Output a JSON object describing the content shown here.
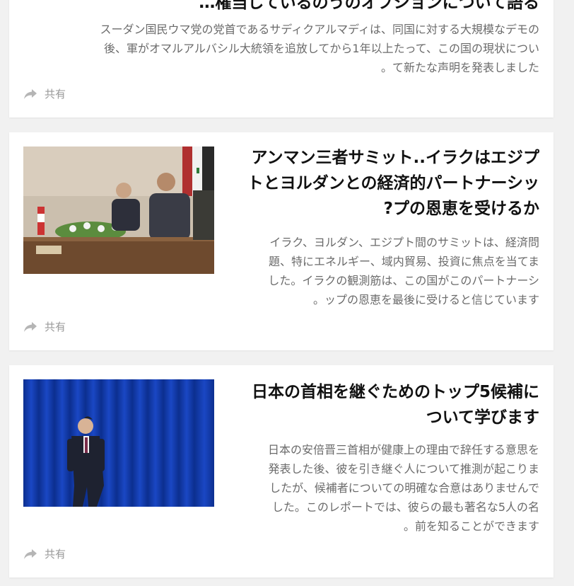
{
  "share_label": "共有",
  "articles": [
    {
      "title": "…権当しているのうのオプションについて語る",
      "excerpt_lines": [
        "スーダン国民ウマ党の党首であるサディクアルマディは、同国に対する大規模なデモの",
        "後、軍がオマルアルバシル大統領を追放してから1年以上たって、この国の現状につい",
        "。て新たな声明を発表しました"
      ]
    },
    {
      "title_lines": [
        "アンマン三者サミット..イラクはエジプ",
        "トとヨルダンとの経済的パートナーシッ",
        "?プの恩恵を受けるか"
      ],
      "excerpt_lines": [
        "イラク、ヨルダン、エジプト間のサミットは、経済問",
        "題、特にエネルギー、域内貿易、投資に焦点を当てま",
        "した。イラクの観測筋は、この国がこのパートナーシ",
        "。ップの恩恵を最後に受けると信じています"
      ],
      "image_alt": "summit-photo"
    },
    {
      "title_lines": [
        "日本の首相を継ぐためのトップ5候補に",
        "ついて学びます"
      ],
      "excerpt_lines": [
        "日本の安倍晋三首相が健康上の理由で辞任する意思を",
        "発表した後、彼を引き継ぐ人について推測が起こりま",
        "したが、候補者についての明確な合意はありませんで",
        "した。このレポートでは、彼らの最も著名な5人の名",
        "。前を知ることができます"
      ],
      "image_alt": "prime-minister-photo"
    }
  ],
  "colors": {
    "page_bg": "#f1f1f1",
    "card_bg": "#ffffff",
    "title": "#111111",
    "excerpt": "#6b6b6b",
    "share": "#9a9a9a"
  }
}
